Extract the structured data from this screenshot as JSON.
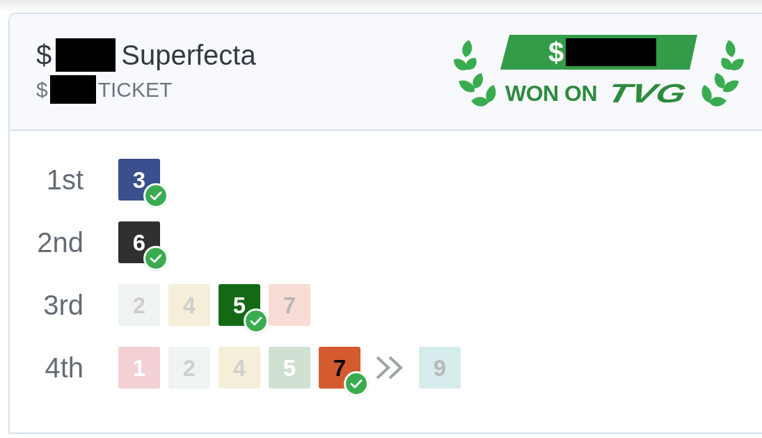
{
  "ticket": {
    "title": [
      {
        "kind": "text",
        "text": "$"
      },
      {
        "kind": "redacted"
      },
      {
        "kind": "text",
        "text": "Superfecta"
      }
    ],
    "subtitle": [
      {
        "kind": "text",
        "text": "$"
      },
      {
        "kind": "redacted"
      },
      {
        "kind": "text",
        "text": "TICKET"
      }
    ]
  },
  "win_badge": {
    "amount": [
      {
        "kind": "text",
        "text": "$"
      },
      {
        "kind": "redacted"
      }
    ],
    "caption": "WON ON",
    "logo": "TVG"
  },
  "positions": [
    {
      "label": "1st",
      "runners": [
        {
          "kind": "runner",
          "number": {
            "text": "3",
            "color": "#ffffff"
          },
          "color": "#3a4f8e",
          "won": true
        }
      ]
    },
    {
      "label": "2nd",
      "runners": [
        {
          "kind": "runner",
          "number": {
            "text": "6",
            "color": "#ffffff"
          },
          "color": "#303030",
          "won": true
        }
      ]
    },
    {
      "label": "3rd",
      "runners": [
        {
          "kind": "runner",
          "number": {
            "text": "2",
            "color": "#cfcfcf"
          },
          "color": "#eff3f4",
          "won": false
        },
        {
          "kind": "runner",
          "number": {
            "text": "4",
            "color": "#d0d0d0"
          },
          "color": "#f5efd9",
          "won": false
        },
        {
          "kind": "runner",
          "number": {
            "text": "5",
            "color": "#ffffff"
          },
          "color": "#146a14",
          "won": true
        },
        {
          "kind": "runner",
          "number": {
            "text": "7",
            "color": "#b8b8b8"
          },
          "color": "#f7ddd5",
          "won": false
        }
      ]
    },
    {
      "label": "4th",
      "runners": [
        {
          "kind": "runner",
          "number": {
            "text": "1",
            "color": "#ffffff"
          },
          "color": "#f3d1d3",
          "won": false
        },
        {
          "kind": "runner",
          "number": {
            "text": "2",
            "color": "#cfcfcf"
          },
          "color": "#eff3f4",
          "won": false
        },
        {
          "kind": "runner",
          "number": {
            "text": "4",
            "color": "#d0d0d0"
          },
          "color": "#f5efd9",
          "won": false
        },
        {
          "kind": "runner",
          "number": {
            "text": "5",
            "color": "#ffffff"
          },
          "color": "#d0e1d1",
          "won": false
        },
        {
          "kind": "runner",
          "number": {
            "text": "7",
            "color": "#000000"
          },
          "color": "#d45a2f",
          "won": true
        },
        {
          "kind": "skip"
        },
        {
          "kind": "runner",
          "number": {
            "text": "9",
            "color": "#b8b8b8"
          },
          "color": "#d4ecec",
          "won": false
        }
      ]
    }
  ]
}
